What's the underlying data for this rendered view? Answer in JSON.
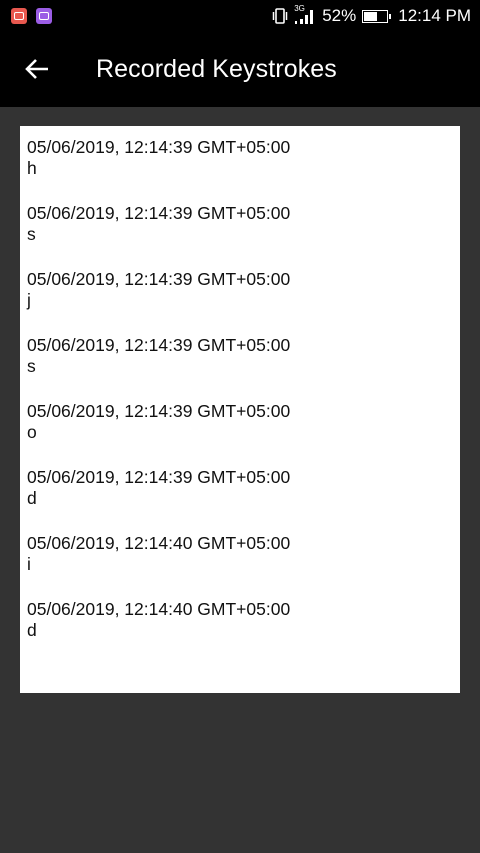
{
  "status_bar": {
    "network_type": "3G",
    "battery_percent": "52%",
    "time": "12:14 PM",
    "battery_level": 0.52
  },
  "app_bar": {
    "title": "Recorded Keystrokes"
  },
  "entries": [
    {
      "timestamp": "05/06/2019, 12:14:39 GMT+05:00",
      "key": "h"
    },
    {
      "timestamp": "05/06/2019, 12:14:39 GMT+05:00",
      "key": "s"
    },
    {
      "timestamp": "05/06/2019, 12:14:39 GMT+05:00",
      "key": "j"
    },
    {
      "timestamp": "05/06/2019, 12:14:39 GMT+05:00",
      "key": "s"
    },
    {
      "timestamp": "05/06/2019, 12:14:39 GMT+05:00",
      "key": "o"
    },
    {
      "timestamp": "05/06/2019, 12:14:39 GMT+05:00",
      "key": "d"
    },
    {
      "timestamp": "05/06/2019, 12:14:40 GMT+05:00",
      "key": "i"
    },
    {
      "timestamp": "05/06/2019, 12:14:40 GMT+05:00",
      "key": "d"
    }
  ],
  "colors": {
    "app_bar": "#000000",
    "background": "#333333",
    "card": "#ffffff"
  }
}
